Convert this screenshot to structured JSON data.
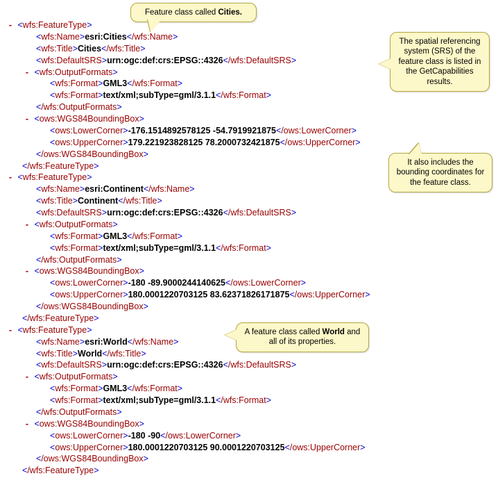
{
  "callouts": {
    "c1_pre": "Feature class called ",
    "c1_bold": "Cities.",
    "c2": "The spatial referencing system (SRS) of the feature class is listed in the GetCapabilities results.",
    "c3": "It also includes the bounding coordinates for the feature class.",
    "c4_pre": "A feature class called ",
    "c4_bold": "World",
    "c4_post": " and all of its properties."
  },
  "tags": {
    "featureType_open": "wfs:FeatureType",
    "featureType_close": "/wfs:FeatureType",
    "name_open": "wfs:Name",
    "name_close": "/wfs:Name",
    "title_open": "wfs:Title",
    "title_close": "/wfs:Title",
    "srs_open": "wfs:DefaultSRS",
    "srs_close": "/wfs:DefaultSRS",
    "of_open": "wfs:OutputFormats",
    "of_close": "/wfs:OutputFormats",
    "format_open": "wfs:Format",
    "format_close": "/wfs:Format",
    "bbox_open": "ows:WGS84BoundingBox",
    "bbox_close": "/ows:WGS84BoundingBox",
    "lc_open": "ows:LowerCorner",
    "lc_close": "/ows:LowerCorner",
    "uc_open": "ows:UpperCorner",
    "uc_close": "/ows:UpperCorner"
  },
  "common": {
    "srs": "urn:ogc:def:crs:EPSG::4326",
    "format1": "GML3",
    "format2": "text/xml;subType=gml/3.1.1"
  },
  "features": {
    "cities": {
      "name": "esri:Cities",
      "title": "Cities",
      "lower": "-176.1514892578125 -54.7919921875",
      "upper": "179.221923828125 78.2000732421875"
    },
    "continent": {
      "name": "esri:Continent",
      "title": "Continent",
      "lower": "-180 -89.9000244140625",
      "upper": "180.0001220703125 83.62371826171875"
    },
    "world": {
      "name": "esri:World",
      "title": "World",
      "lower": "-180 -90",
      "upper": "180.0001220703125 90.0001220703125"
    }
  }
}
